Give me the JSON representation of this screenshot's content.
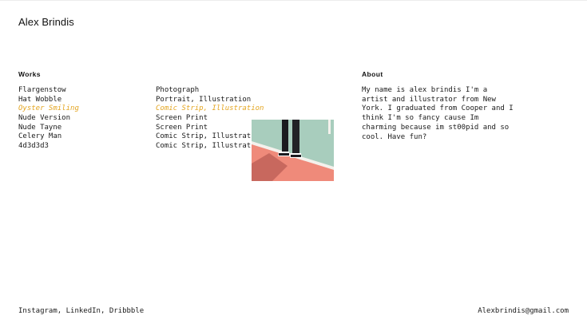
{
  "site": {
    "name": "Alex Brindis"
  },
  "works": {
    "heading": "Works",
    "items": [
      {
        "title": "Flargenstow",
        "category": "Photograph",
        "active": false
      },
      {
        "title": "Hat Wobble",
        "category": "Portrait, Illustration",
        "active": false
      },
      {
        "title": "Oyster Smiling",
        "category": "Comic Strip, Illustration",
        "active": true
      },
      {
        "title": "Nude Version",
        "category": "Screen Print",
        "active": false
      },
      {
        "title": "Nude Tayne",
        "category": "Screen Print",
        "active": false
      },
      {
        "title": "Celery Man",
        "category": "Comic Strip, Illustrat.",
        "active": false
      },
      {
        "title": "4d3d3d3",
        "category": "Comic Strip, Illustrat.",
        "active": false
      }
    ],
    "active_color": "#e4a622"
  },
  "about": {
    "heading": "About",
    "text": "My name is alex brindis I'm a artist and illustrator from New York. I graduated from Cooper and I think I'm so fancy cause Im charming because im st00pid and so cool. Have fun?"
  },
  "footer": {
    "links": [
      {
        "label": "Instagram"
      },
      {
        "label": "LinkedIn"
      },
      {
        "label": "Dribbble"
      }
    ],
    "separator": ", ",
    "email": "Alexbrindis@gmail.com"
  },
  "preview": {
    "court_green": "#a8cdbd",
    "court_coral": "#ef8a7a",
    "line_white": "#f4f1ec"
  }
}
